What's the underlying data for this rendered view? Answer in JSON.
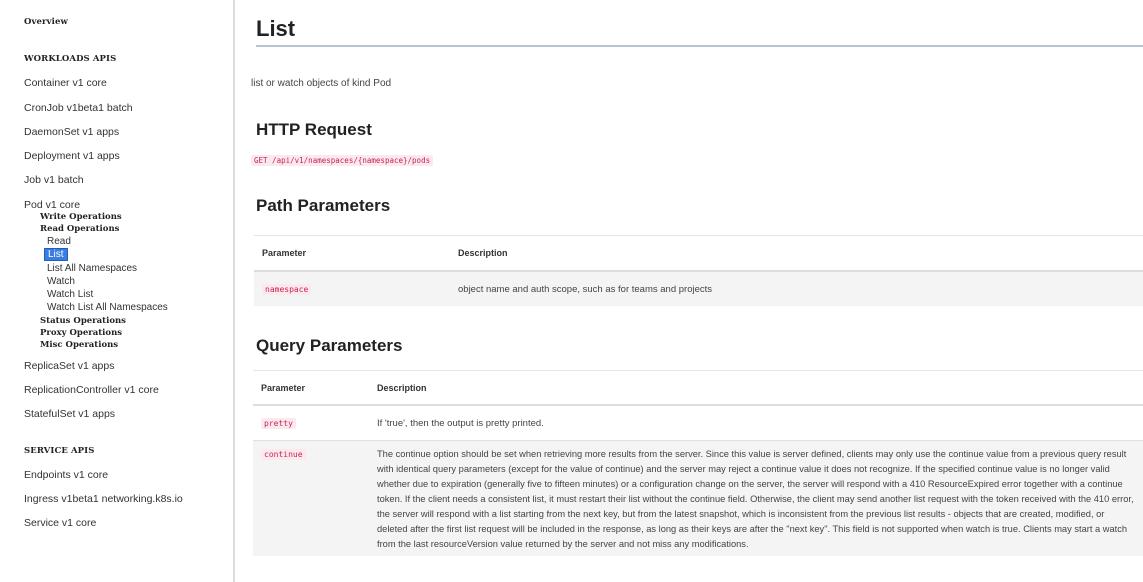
{
  "sidebar": {
    "overview": "Overview",
    "workloads_header": "WORKLOADS APIS",
    "workloads": [
      "Container v1 core",
      "CronJob v1beta1 batch",
      "DaemonSet v1 apps",
      "Deployment v1 apps",
      "Job v1 batch",
      "Pod v1 core"
    ],
    "pod_groups": {
      "write": "Write Operations",
      "read": "Read Operations",
      "read_items": [
        "Read",
        "List",
        "List All Namespaces",
        "Watch",
        "Watch List",
        "Watch List All Namespaces"
      ],
      "status": "Status Operations",
      "proxy": "Proxy Operations",
      "misc": "Misc Operations"
    },
    "workloads_after": [
      "ReplicaSet v1 apps",
      "ReplicationController v1 core",
      "StatefulSet v1 apps"
    ],
    "service_header": "SERVICE APIS",
    "service": [
      "Endpoints v1 core",
      "Ingress v1beta1 networking.k8s.io",
      "Service v1 core"
    ],
    "active_item": "List"
  },
  "main": {
    "title": "List",
    "summary": "list or watch objects of kind Pod",
    "http_heading": "HTTP Request",
    "http_request": "GET /api/v1/namespaces/{namespace}/pods",
    "path_heading": "Path Parameters",
    "path_table": {
      "headers": [
        "Parameter",
        "Description"
      ],
      "rows": [
        {
          "param": "namespace",
          "desc": "object name and auth scope, such as for teams and projects"
        }
      ]
    },
    "query_heading": "Query Parameters",
    "query_table": {
      "headers": [
        "Parameter",
        "Description"
      ],
      "rows": [
        {
          "param": "pretty",
          "desc": "If 'true', then the output is pretty printed."
        },
        {
          "param": "continue",
          "desc": "The continue option should be set when retrieving more results from the server. Since this value is server defined, clients may only use the continue value from a previous query result with identical query parameters (except for the value of continue) and the server may reject a continue value it does not recognize. If the specified continue value is no longer valid whether due to expiration (generally five to fifteen minutes) or a configuration change on the server, the server will respond with a 410 ResourceExpired error together with a continue token. If the client needs a consistent list, it must restart their list without the continue field. Otherwise, the client may send another list request with the token received with the 410 error, the server will respond with a list starting from the next key, but from the latest snapshot, which is inconsistent from the previous list results - objects that are created, modified, or deleted after the first list request will be included in the response, as long as their keys are after the \"next key\". This field is not supported when watch is true. Clients may start a watch from the last resourceVersion value returned by the server and not miss any modifications."
        }
      ]
    }
  },
  "colors": {
    "accent": "#3b7de0",
    "code": "#c7254e",
    "code_bg": "#fbe9ef"
  }
}
